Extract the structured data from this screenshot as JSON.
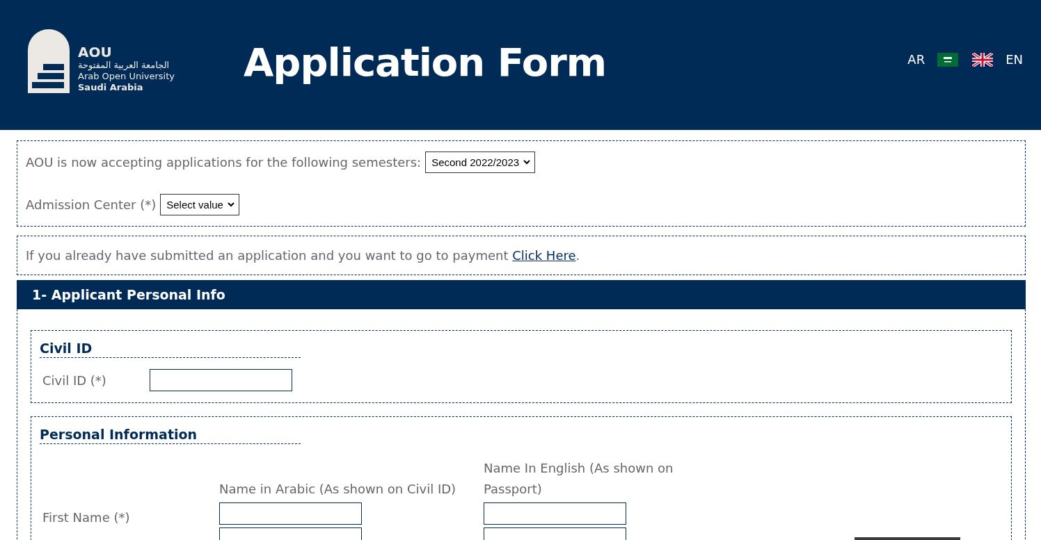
{
  "header": {
    "logo": {
      "abbr": "AOU",
      "arabic_name": "الجامعة العربية المفتوحة",
      "name": "Arab Open University",
      "country": "Saudi Arabia"
    },
    "title": "Application Form",
    "languages": [
      {
        "label": "AR",
        "kind": "saudi"
      },
      {
        "label": "EN",
        "kind": "uk"
      }
    ]
  },
  "semester_box": {
    "semester_label": "AOU is now accepting applications for the following semesters:",
    "semester_value": "Second 2022/2023",
    "center_label": "Admission Center (*)",
    "center_value": "Select value"
  },
  "payment_notice": {
    "text": "If you already have submitted an application and you want to go to payment",
    "link": "Click Here",
    "trail": "."
  },
  "section": {
    "title": "1- Applicant Personal Info",
    "civil_id": {
      "title": "Civil ID",
      "fields": [
        {
          "label": "Civil ID (*)"
        }
      ]
    },
    "personal_information": {
      "title": "Personal Information",
      "columns": [
        "Name in Arabic (As shown on Civil ID)",
        "Name In English (As shown on Passport)"
      ],
      "rows": [
        {
          "label": "First Name (*)"
        },
        {
          "label": null
        }
      ]
    }
  }
}
